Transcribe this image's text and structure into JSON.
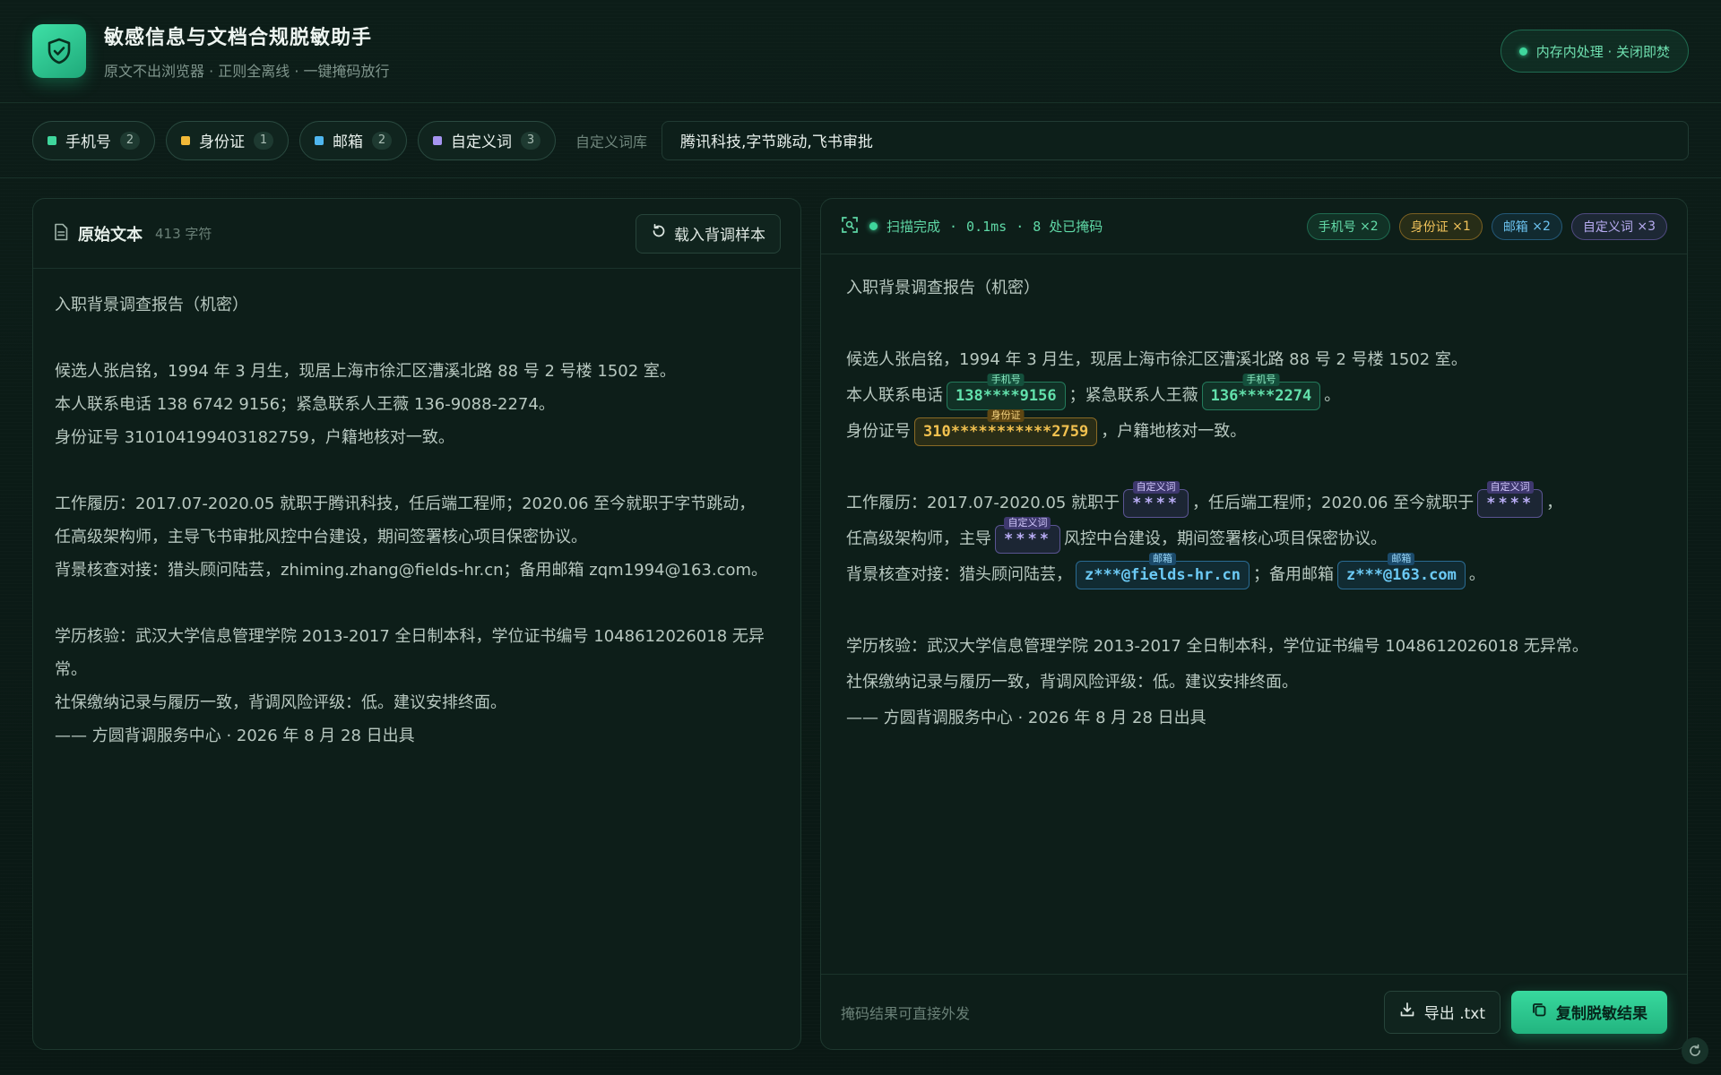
{
  "header": {
    "title": "敏感信息与文档合规脱敏助手",
    "subtitle": "原文不出浏览器 · 正则全离线 · 一键掩码放行",
    "privacy": "内存内处理 · 关闭即焚"
  },
  "toolbar": {
    "chips": [
      {
        "label": "手机号",
        "count": "2",
        "color": "#3fd69c"
      },
      {
        "label": "身份证",
        "count": "1",
        "color": "#f2b938"
      },
      {
        "label": "邮箱",
        "count": "2",
        "color": "#4fb6ef"
      },
      {
        "label": "自定义词",
        "count": "3",
        "color": "#a594f0"
      }
    ],
    "dict_label": "自定义词库",
    "dict_value": "腾讯科技,字节跳动,飞书审批"
  },
  "source": {
    "title": "原始文本",
    "char_count": "413",
    "char_unit": "字符",
    "load_button": "载入背调样本",
    "lines": [
      "入职背景调查报告（机密）",
      "",
      "候选人张启铭，1994 年 3 月生，现居上海市徐汇区漕溪北路 88 号 2 号楼 1502 室。",
      "本人联系电话 138 6742 9156；紧急联系人王薇 136-9088-2274。",
      "身份证号 310104199403182759，户籍地核对一致。",
      "",
      "工作履历：2017.07-2020.05 就职于腾讯科技，任后端工程师；2020.06 至今就职于字节跳动，",
      "任高级架构师，主导飞书审批风控中台建设，期间签署核心项目保密协议。",
      "背景核查对接：猎头顾问陆芸，zhiming.zhang@fields-hr.cn；备用邮箱 zqm1994@163.com。",
      "",
      "学历核验：武汉大学信息管理学院 2013-2017 全日制本科，学位证书编号 1048612026018 无异常。",
      "社保缴纳记录与履历一致，背调风险评级：低。建议安排终面。",
      "—— 方圆背调服务中心 · 2026 年 8 月 28 日出具"
    ]
  },
  "result": {
    "status": "扫描完成",
    "time": "0.1ms",
    "masked_count": "8 处已掩码",
    "tags": [
      {
        "label": "手机号",
        "count": "×2"
      },
      {
        "label": "身份证",
        "count": "×1"
      },
      {
        "label": "邮箱",
        "count": "×2"
      },
      {
        "label": "自定义词",
        "count": "×3"
      }
    ],
    "line1": "入职背景调查报告（机密）",
    "line3": "候选人张启铭，1994 年 3 月生，现居上海市徐汇区漕溪北路 88 号 2 号楼 1502 室。",
    "line4": {
      "pre": "本人联系电话",
      "mask1": "138****9156",
      "mid": "；紧急联系人王薇",
      "mask2": "136****2274",
      "post": "。"
    },
    "line5": {
      "pre": "身份证号",
      "mask": "310***********2759",
      "post": "，户籍地核对一致。"
    },
    "line7": {
      "pre": "工作履历：2017.07-2020.05 就职于",
      "mask1": "****",
      "mid": "，任后端工程师；2020.06 至今就职于",
      "mask2": "****",
      "post": "，"
    },
    "line8": {
      "pre": "任高级架构师，主导",
      "mask": "****",
      "post": "风控中台建设，期间签署核心项目保密协议。"
    },
    "line9": {
      "pre": "背景核查对接：猎头顾问陆芸，",
      "mask1": "z***@fields-hr.cn",
      "mid": "；备用邮箱",
      "mask2": "z***@163.com",
      "post": "。"
    },
    "line11": "学历核验：武汉大学信息管理学院 2013-2017 全日制本科，学位证书编号 1048612026018 无异常。",
    "line12": "社保缴纳记录与履历一致，背调风险评级：低。建议安排终面。",
    "line13": "—— 方圆背调服务中心 · 2026 年 8 月 28 日出具",
    "labels": {
      "phone": "手机号",
      "id": "身份证",
      "mail": "邮箱",
      "custom": "自定义词"
    },
    "foot_hint": "掩码结果可直接外发",
    "export_button": "导出 .txt",
    "copy_button": "复制脱敏结果"
  },
  "icons": {
    "logo": "shield-check-icon",
    "doc": "document-icon",
    "reload": "reload-icon",
    "scan": "scan-icon",
    "download": "download-icon",
    "copy": "copy-icon",
    "refresh": "refresh-icon"
  }
}
